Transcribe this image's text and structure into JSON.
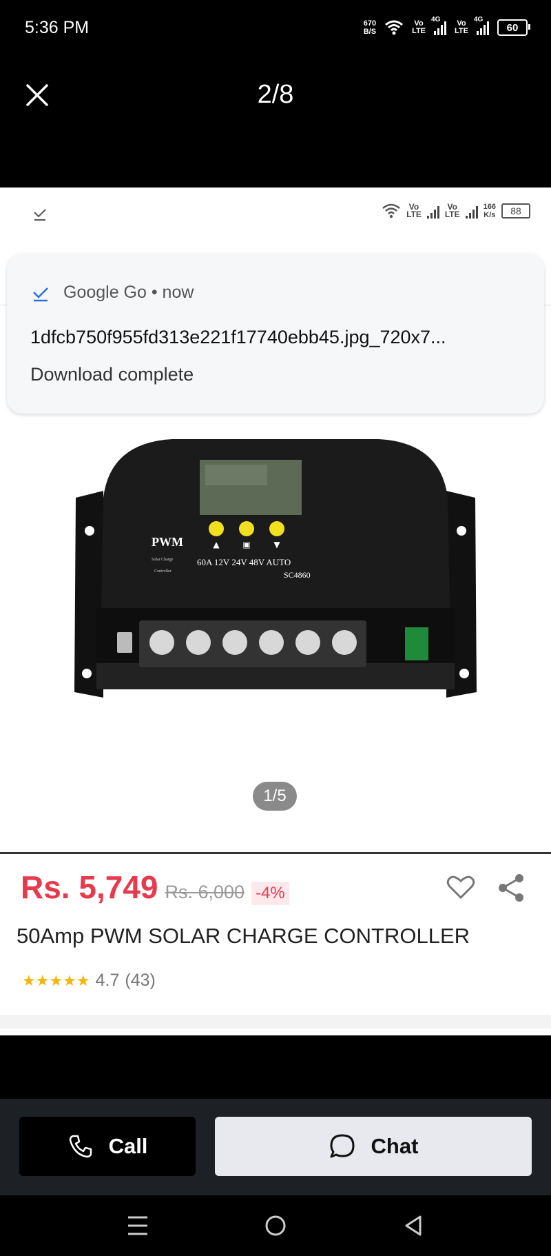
{
  "status_bar": {
    "time": "5:36 PM",
    "net_speed_value": "670",
    "net_speed_unit": "B/S",
    "sim1_label_top": "Vo",
    "sim1_label_bottom": "LTE",
    "sim1_net": "4G",
    "sim2_label_top": "Vo",
    "sim2_label_bottom": "LTE",
    "sim2_net": "4G",
    "battery": "60"
  },
  "viewer": {
    "counter": "2/8"
  },
  "inner_status": {
    "sim1_top": "Vo",
    "sim1_bottom": "LTE",
    "sim2_top": "Vo",
    "sim2_bottom": "LTE",
    "speed_value": "166",
    "speed_unit": "K/s",
    "battery": "88"
  },
  "notification": {
    "app_line": "Google Go • now",
    "file_name": "1dfcb750f955fd313e221f17740ebb45.jpg_720x7...",
    "status": "Download complete"
  },
  "product_image": {
    "counter": "1/5",
    "label_pwm": "PWM",
    "label_sub1": "Solar Charge",
    "label_sub2": "Controller",
    "label_specs": "60A 12V 24V 48V AUTO",
    "label_model": "SC4860"
  },
  "listing": {
    "price": "Rs. 5,749",
    "old_price": "Rs. 6,000",
    "discount": "-4%",
    "title": "50Amp PWM SOLAR CHARGE CONTROLLER",
    "rating": "4.7",
    "rating_count": "(43)",
    "stars": "★★★★★"
  },
  "actions": {
    "call_label": "Call",
    "chat_label": "Chat"
  },
  "colors": {
    "price": "#e8394d",
    "star": "#f5b50a",
    "action_bar": "#1d2025"
  }
}
